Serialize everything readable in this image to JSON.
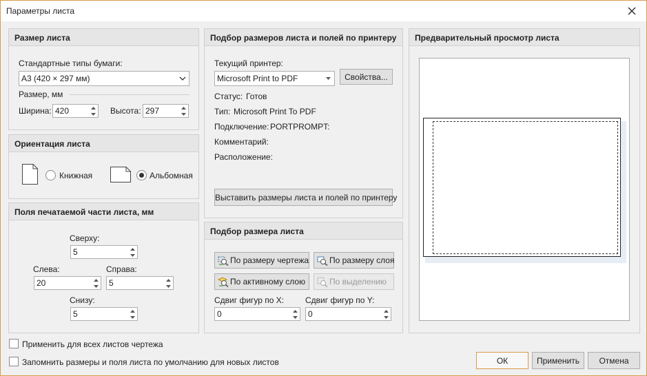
{
  "window": {
    "title": "Параметры листа"
  },
  "size_panel": {
    "header": "Размер листа",
    "paper_types_label": "Стандартные типы бумаги:",
    "paper_type_value": "A3 (420 × 297 мм)",
    "size_label": "Размер, мм",
    "width_label": "Ширина:",
    "width_value": "420",
    "height_label": "Высота:",
    "height_value": "297"
  },
  "orientation_panel": {
    "header": "Ориентация листа",
    "portrait_label": "Книжная",
    "landscape_label": "Альбомная",
    "selected": "landscape"
  },
  "margins_panel": {
    "header": "Поля печатаемой части листа, мм",
    "top_label": "Сверху:",
    "top_value": "5",
    "left_label": "Слева:",
    "left_value": "20",
    "right_label": "Справа:",
    "right_value": "5",
    "bottom_label": "Снизу:",
    "bottom_value": "5"
  },
  "printer_panel": {
    "header": "Подбор размеров листа и полей по принтеру",
    "current_printer_label": "Текущий принтер:",
    "printer_value": "Microsoft Print to PDF",
    "properties_button": "Свойства...",
    "status_label": "Статус:",
    "status_value": "Готов",
    "type_label": "Тип:",
    "type_value": "Microsoft Print To PDF",
    "connection_label": "Подключение:",
    "connection_value": "PORTPROMPT:",
    "comment_label": "Комментарий:",
    "location_label": "Расположение:",
    "fit_button": "Выставить размеры листа и полей по принтеру"
  },
  "fit_panel": {
    "header": "Подбор размера листа",
    "by_drawing": "По размеру чертежа",
    "by_layer": "По размеру слоя",
    "by_active_layer": "По активному слою",
    "by_selection": "По выделению",
    "shift_x_label": "Сдвиг фигур по X:",
    "shift_x_value": "0",
    "shift_y_label": "Сдвиг фигур по Y:",
    "shift_y_value": "0"
  },
  "preview_panel": {
    "header": "Предварительный просмотр листа"
  },
  "footer": {
    "apply_all_label": "Применить для всех листов чертежа",
    "remember_label": "Запомнить размеры и поля листа по умолчанию для новых листов",
    "ok": "ОК",
    "apply": "Применить",
    "cancel": "Отмена"
  },
  "colors": {
    "accent": "#d99a4a",
    "panel_header": "#e6e6e6",
    "dialog_bg": "#f0f0f0"
  },
  "icons": [
    "close-icon",
    "chevron-down-icon",
    "spin-up-icon",
    "spin-down-icon",
    "portrait-page-icon",
    "landscape-page-icon",
    "zoom-drawing-icon",
    "zoom-layer-icon",
    "zoom-active-layer-icon",
    "zoom-selection-icon"
  ]
}
